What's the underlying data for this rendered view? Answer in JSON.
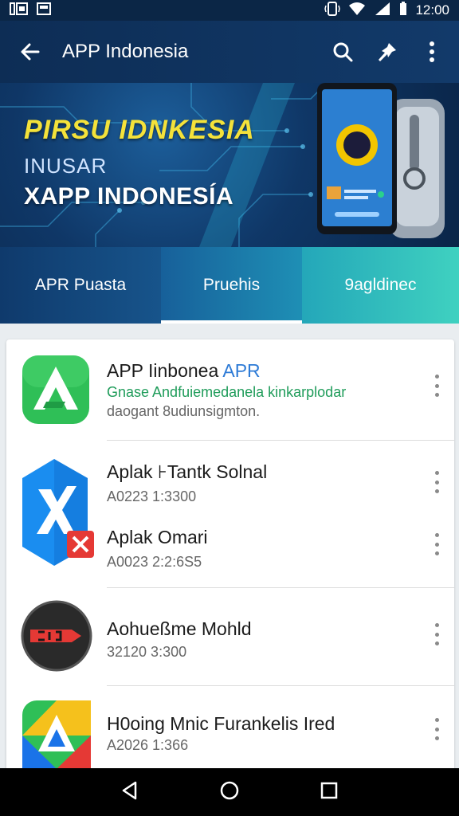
{
  "status_bar": {
    "time": "12:00"
  },
  "app_bar": {
    "title": "APP Indonesia"
  },
  "banner": {
    "headline": "PIRSU IDNKESIA",
    "sub": "INUSAR",
    "brand": "XAPP INDONESÍA"
  },
  "tabs": [
    {
      "label": "APR Puasta"
    },
    {
      "label": "Pruehis"
    },
    {
      "label": "9agldinec"
    }
  ],
  "apps": [
    {
      "title": "APP Iinbonea",
      "title_accent": "APR",
      "desc_line1": "Gnase Andfuiemedanela kinkarplodar",
      "desc_line2": "daogant 8udiunsigmton."
    },
    {
      "title": "Aplak ⊦Tantk Solnal",
      "meta": "A0223 1:3300"
    },
    {
      "title": "Aplak Omari",
      "meta": "A0023 2:2:6S5"
    },
    {
      "title": "Aohueßme Mohld",
      "meta": "32120 3:300"
    },
    {
      "title": "H0oing Mnic Furankelis Ired",
      "meta": "A2026 1:366"
    }
  ],
  "colors": {
    "appbar": "#0d2d55",
    "accent_yellow": "#f4e23a",
    "desc_green": "#1f9c5a",
    "accent_blue": "#2e7bd6"
  }
}
